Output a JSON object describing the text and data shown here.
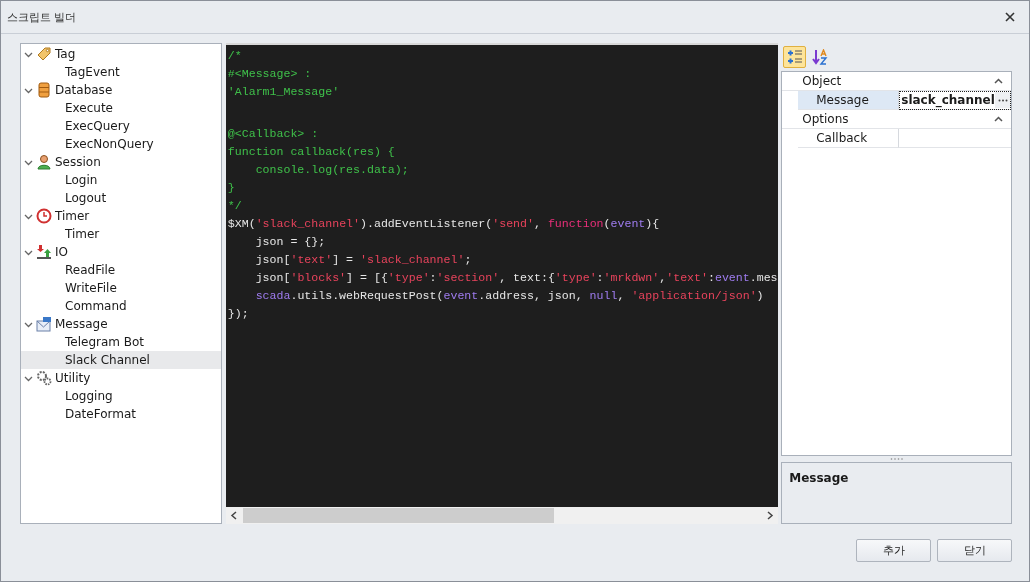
{
  "window": {
    "title": "스크립트 빌더"
  },
  "tree": [
    {
      "label": "Tag",
      "kind": "tag",
      "expanded": true,
      "children": [
        {
          "label": "TagEvent",
          "selected": false
        }
      ]
    },
    {
      "label": "Database",
      "kind": "database",
      "expanded": true,
      "children": [
        {
          "label": "Execute",
          "selected": false
        },
        {
          "label": "ExecQuery",
          "selected": false
        },
        {
          "label": "ExecNonQuery",
          "selected": false
        }
      ]
    },
    {
      "label": "Session",
      "kind": "user",
      "expanded": true,
      "children": [
        {
          "label": "Login",
          "selected": false
        },
        {
          "label": "Logout",
          "selected": false
        }
      ]
    },
    {
      "label": "Timer",
      "kind": "timer",
      "expanded": true,
      "children": [
        {
          "label": "Timer",
          "selected": false
        }
      ]
    },
    {
      "label": "IO",
      "kind": "io",
      "expanded": true,
      "children": [
        {
          "label": "ReadFile",
          "selected": false
        },
        {
          "label": "WriteFile",
          "selected": false
        },
        {
          "label": "Command",
          "selected": false
        }
      ]
    },
    {
      "label": "Message",
      "kind": "message",
      "expanded": true,
      "children": [
        {
          "label": "Telegram Bot",
          "selected": false
        },
        {
          "label": "Slack Channel",
          "selected": true
        }
      ]
    },
    {
      "label": "Utility",
      "kind": "gears",
      "expanded": true,
      "children": [
        {
          "label": "Logging",
          "selected": false
        },
        {
          "label": "DateFormat",
          "selected": false
        }
      ]
    }
  ],
  "code_lines": [
    [
      {
        "kind": "comment",
        "text": "/*"
      }
    ],
    [
      {
        "kind": "comment",
        "text": "#<Message> :"
      }
    ],
    [
      {
        "kind": "comment",
        "text": "'Alarm1_Message'"
      }
    ],
    [
      {
        "kind": "blank"
      }
    ],
    [
      {
        "kind": "comment",
        "text": "@<Callback> :"
      }
    ],
    [
      {
        "kind": "comment",
        "text": "function callback(res) {"
      }
    ],
    [
      {
        "kind": "comment",
        "text": "    console.log(res.data);"
      }
    ],
    [
      {
        "kind": "comment",
        "text": "}"
      }
    ],
    [
      {
        "kind": "comment",
        "text": "*/"
      }
    ],
    [
      {
        "kind": "plain",
        "text": "$XM("
      },
      {
        "kind": "string",
        "text": "'slack_channel'"
      },
      {
        "kind": "plain",
        "text": ").addEventListener("
      },
      {
        "kind": "string",
        "text": "'send'"
      },
      {
        "kind": "plain",
        "text": ", "
      },
      {
        "kind": "keyword",
        "text": "function"
      },
      {
        "kind": "plain",
        "text": "("
      },
      {
        "kind": "var",
        "text": "event"
      },
      {
        "kind": "plain",
        "text": "){"
      }
    ],
    [
      {
        "kind": "plain",
        "text": "    json = {};"
      }
    ],
    [
      {
        "kind": "plain",
        "text": "    json["
      },
      {
        "kind": "string",
        "text": "'text'"
      },
      {
        "kind": "plain",
        "text": "] = "
      },
      {
        "kind": "string",
        "text": "'slack_channel'"
      },
      {
        "kind": "plain",
        "text": ";"
      }
    ],
    [
      {
        "kind": "plain",
        "text": "    json["
      },
      {
        "kind": "string",
        "text": "'blocks'"
      },
      {
        "kind": "plain",
        "text": "] = [{"
      },
      {
        "kind": "string",
        "text": "'type'"
      },
      {
        "kind": "plain",
        "text": ":"
      },
      {
        "kind": "string",
        "text": "'section'"
      },
      {
        "kind": "plain",
        "text": ", text:{"
      },
      {
        "kind": "string",
        "text": "'type'"
      },
      {
        "kind": "plain",
        "text": ":"
      },
      {
        "kind": "string",
        "text": "'mrkdwn'"
      },
      {
        "kind": "plain",
        "text": ","
      },
      {
        "kind": "string",
        "text": "'text'"
      },
      {
        "kind": "plain",
        "text": ":"
      },
      {
        "kind": "var",
        "text": "event"
      },
      {
        "kind": "plain",
        "text": ".mes"
      }
    ],
    [
      {
        "kind": "var",
        "text": "    scada"
      },
      {
        "kind": "plain",
        "text": ".utils.webRequestPost("
      },
      {
        "kind": "var",
        "text": "event"
      },
      {
        "kind": "plain",
        "text": ".address, json, "
      },
      {
        "kind": "var",
        "text": "null"
      },
      {
        "kind": "plain",
        "text": ", "
      },
      {
        "kind": "string",
        "text": "'application/json'"
      },
      {
        "kind": "plain",
        "text": ")"
      }
    ],
    [
      {
        "kind": "plain",
        "text": "});"
      }
    ]
  ],
  "toolbar": [
    {
      "kind": "categorized",
      "selected": true
    },
    {
      "kind": "alphabetical",
      "selected": false
    }
  ],
  "properties": [
    {
      "category": "Object",
      "expanded": true,
      "rows": [
        {
          "name": "Message",
          "value": "slack_channel",
          "selected": true
        }
      ]
    },
    {
      "category": "Options",
      "expanded": true,
      "rows": [
        {
          "name": "Callback",
          "selected": false
        }
      ]
    }
  ],
  "description": {
    "title": "Message"
  },
  "buttons": [
    "추가",
    "닫기"
  ]
}
